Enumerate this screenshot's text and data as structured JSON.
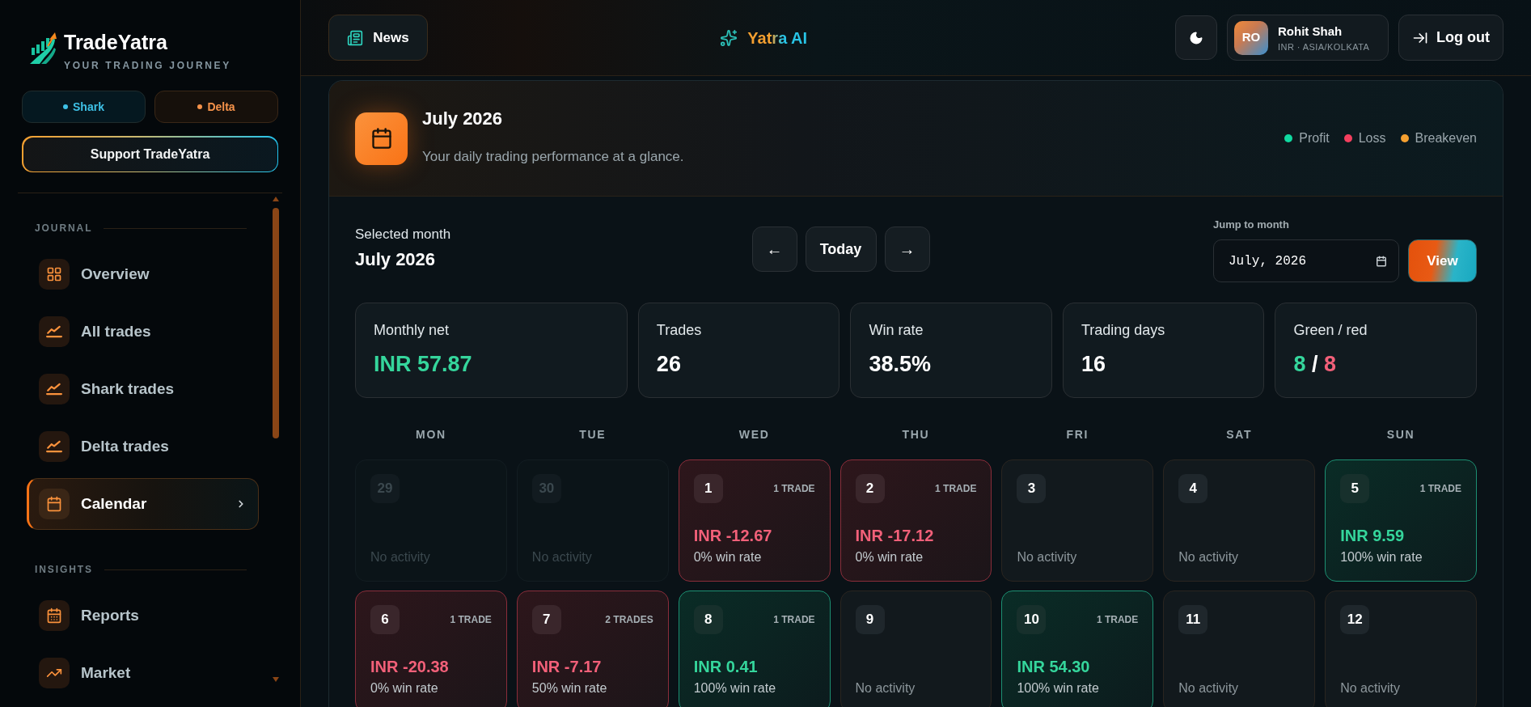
{
  "brand": {
    "name": "TradeYatra",
    "tagline": "YOUR TRADING JOURNEY"
  },
  "accounts": [
    {
      "label": "Shark",
      "color": "#3ec1e6"
    },
    {
      "label": "Delta",
      "color": "#f5924a"
    }
  ],
  "support_button": {
    "label": "Support TradeYatra"
  },
  "sidebar": {
    "sections": [
      {
        "title": "JOURNAL",
        "items": [
          {
            "label": "Overview",
            "selected": false
          },
          {
            "label": "All trades",
            "selected": false
          },
          {
            "label": "Shark trades",
            "selected": false
          },
          {
            "label": "Delta trades",
            "selected": false
          },
          {
            "label": "Calendar",
            "selected": true
          }
        ]
      },
      {
        "title": "INSIGHTS",
        "items": [
          {
            "label": "Reports",
            "selected": false
          },
          {
            "label": "Market",
            "selected": false
          }
        ]
      }
    ]
  },
  "header": {
    "news_button": "News",
    "assistant": "Yatra AI",
    "user": {
      "initials": "RO",
      "name": "Rohit Shah",
      "details": "INR · ASIA/KOLKATA"
    },
    "logout_button": "Log out"
  },
  "calendar_card": {
    "title": "July 2026",
    "subtitle": "Your daily trading performance at a glance.",
    "legend": [
      {
        "label": "Profit",
        "color": "#10d9a0"
      },
      {
        "label": "Loss",
        "color": "#f43f5e"
      },
      {
        "label": "Breakeven",
        "color": "#f5a030"
      }
    ],
    "selected_month": {
      "label": "Selected month",
      "value": "July 2026"
    },
    "navigation": {
      "previous": "←",
      "today": "Today",
      "next": "→"
    },
    "jump": {
      "label": "Jump to month",
      "value": "July, 2026",
      "button": "View"
    },
    "stats": [
      {
        "label": "Monthly net",
        "kind": "profit",
        "value": "INR 57.87"
      },
      {
        "label": "Trades",
        "kind": "plain",
        "value": "26"
      },
      {
        "label": "Win rate",
        "kind": "plain",
        "value": "38.5%"
      },
      {
        "label": "Trading days",
        "kind": "plain",
        "value": "16"
      },
      {
        "label": "Green / red",
        "kind": "split",
        "green": "8",
        "separator": "/",
        "red": "8"
      }
    ],
    "weekdays": [
      "MON",
      "TUE",
      "WED",
      "THU",
      "FRI",
      "SAT",
      "SUN"
    ],
    "days": [
      {
        "day": "29",
        "kind": "outside",
        "note": "No activity"
      },
      {
        "day": "30",
        "kind": "outside",
        "note": "No activity"
      },
      {
        "day": "1",
        "kind": "loss",
        "trades": "1 TRADE",
        "pnl": "INR -12.67",
        "win_rate": "0% win rate"
      },
      {
        "day": "2",
        "kind": "loss",
        "trades": "1 TRADE",
        "pnl": "INR -17.12",
        "win_rate": "0% win rate"
      },
      {
        "day": "3",
        "kind": "empty",
        "note": "No activity"
      },
      {
        "day": "4",
        "kind": "empty",
        "note": "No activity"
      },
      {
        "day": "5",
        "kind": "profit",
        "trades": "1 TRADE",
        "pnl": "INR 9.59",
        "win_rate": "100% win rate"
      },
      {
        "day": "6",
        "kind": "loss",
        "trades": "1 TRADE",
        "pnl": "INR -20.38",
        "win_rate": "0% win rate"
      },
      {
        "day": "7",
        "kind": "loss",
        "trades": "2 TRADES",
        "pnl": "INR -7.17",
        "win_rate": "50% win rate"
      },
      {
        "day": "8",
        "kind": "profit",
        "trades": "1 TRADE",
        "pnl": "INR 0.41",
        "win_rate": "100% win rate"
      },
      {
        "day": "9",
        "kind": "empty",
        "note": "No activity"
      },
      {
        "day": "10",
        "kind": "profit",
        "trades": "1 TRADE",
        "pnl": "INR 54.30",
        "win_rate": "100% win rate"
      },
      {
        "day": "11",
        "kind": "empty",
        "note": "No activity"
      },
      {
        "day": "12",
        "kind": "empty",
        "note": "No activity"
      }
    ]
  }
}
